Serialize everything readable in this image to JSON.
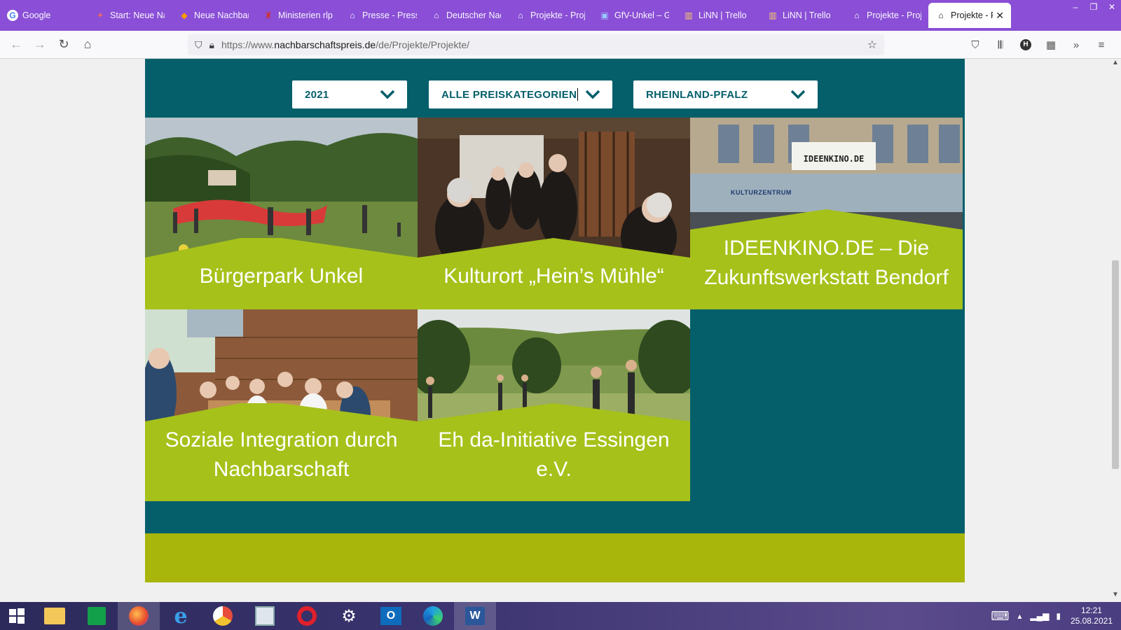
{
  "browser": {
    "tabs": [
      {
        "label": "Google",
        "icon": "G"
      },
      {
        "label": "Start: Neue Na",
        "icon": "✦"
      },
      {
        "label": "Neue Nachbar",
        "icon": "◆"
      },
      {
        "label": "Ministerien rlp",
        "icon": "♜"
      },
      {
        "label": "Presse - Presse",
        "icon": "⌂"
      },
      {
        "label": "Deutscher Nac",
        "icon": "⌂"
      },
      {
        "label": "Projekte - Proj",
        "icon": "⌂"
      },
      {
        "label": "GfV-Unkel – G",
        "icon": "▣"
      },
      {
        "label": "LiNN | Trello",
        "icon": "▥"
      },
      {
        "label": "LiNN | Trello",
        "icon": "▥"
      },
      {
        "label": "Projekte - Proj",
        "icon": "⌂"
      },
      {
        "label": "Projekte - Pr",
        "icon": "⌂"
      }
    ],
    "active_tab_index": 11,
    "url_prefix": "https://www.",
    "url_domain": "nachbarschaftspreis.de",
    "url_path": "/de/Projekte/Projekte/"
  },
  "filters": {
    "year": "2021",
    "category": "ALLE PREISKATEGORIEN",
    "region": "RHEINLAND-PFALZ"
  },
  "projects": [
    {
      "title": "Bürgerpark Unkel"
    },
    {
      "title": "Kulturort „Hein’s Mühle“"
    },
    {
      "title": "IDEENKINO.DE – Die Zukunftswerkstatt Bendorf"
    },
    {
      "title": "Soziale Integration durch Nachbarschaft"
    },
    {
      "title": "Eh da-Initiative Essingen e.V."
    }
  ],
  "photo_texts": {
    "ideenkino_sign": "IDEENKINO.DE",
    "kulturzentrum_sign": "KULTURZENTRUM"
  },
  "taskbar": {
    "time": "12:21",
    "date": "25.08.2021"
  },
  "colors": {
    "teal": "#045f6b",
    "lime": "#a6c11a",
    "olive": "#a8b50a",
    "tabbar": "#8a4fd6"
  }
}
